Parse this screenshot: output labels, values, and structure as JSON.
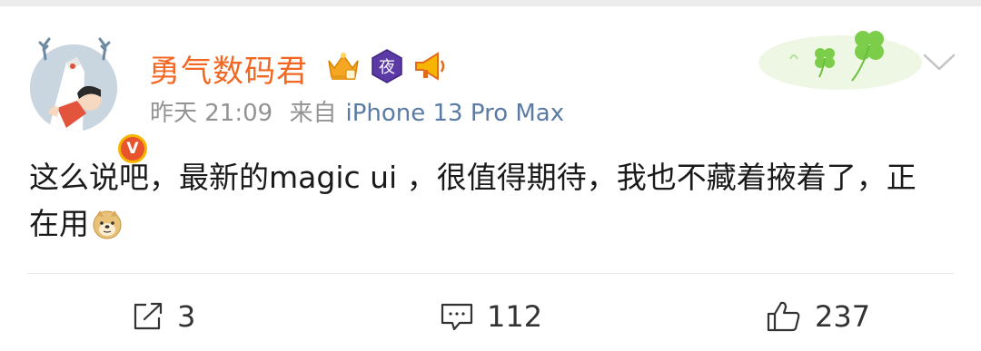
{
  "post": {
    "user": {
      "name": "勇气数码君",
      "badges": [
        "crown-badge",
        "night-badge",
        "megaphone-badge"
      ],
      "night_badge_text": "夜",
      "verified_icon": "v-verified-icon",
      "verified_text": "V"
    },
    "meta": {
      "time": "昨天 21:09",
      "source_prefix": "来自",
      "source": "iPhone 13 Pro Max"
    },
    "content": {
      "text": "这么说吧，最新的magic ui ，很值得期待，我也不藏着掖着了，正在用",
      "emoji": "doge-emoji"
    },
    "actions": {
      "repost": {
        "icon": "share-icon",
        "count": "3"
      },
      "comment": {
        "icon": "comment-icon",
        "count": "112"
      },
      "like": {
        "icon": "thumbs-up-icon",
        "count": "237"
      }
    }
  },
  "colors": {
    "username": "#f26722",
    "meta": "#939393",
    "source": "#5b7ba5",
    "text": "#1a1a1a",
    "clover": "#7ccd4a"
  }
}
